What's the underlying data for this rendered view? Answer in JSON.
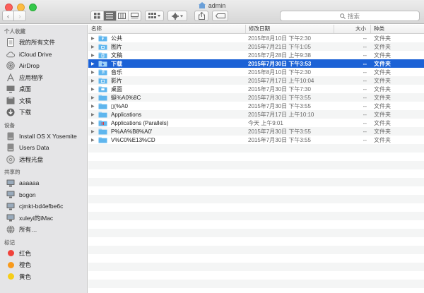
{
  "window": {
    "title": "admin"
  },
  "toolbar": {
    "back": "‹",
    "forward": "›",
    "search_placeholder": "搜索"
  },
  "sidebar": {
    "favorites_title": "个人收藏",
    "favorites": [
      {
        "label": "我的所有文件",
        "icon": "all-files-icon"
      },
      {
        "label": "iCloud Drive",
        "icon": "cloud-icon"
      },
      {
        "label": "AirDrop",
        "icon": "airdrop-icon"
      },
      {
        "label": "应用程序",
        "icon": "applications-icon"
      },
      {
        "label": "桌面",
        "icon": "desktop-icon"
      },
      {
        "label": "文稿",
        "icon": "documents-icon"
      },
      {
        "label": "下载",
        "icon": "downloads-icon"
      }
    ],
    "devices_title": "设备",
    "devices": [
      {
        "label": "Install OS X Yosemite",
        "icon": "disk-icon"
      },
      {
        "label": "Users Data",
        "icon": "disk-icon"
      },
      {
        "label": "远程光盘",
        "icon": "remote-disc-icon"
      }
    ],
    "shared_title": "共享的",
    "shared": [
      {
        "label": "aaaaaa",
        "icon": "monitor-icon"
      },
      {
        "label": "bogon",
        "icon": "monitor-icon"
      },
      {
        "label": "cjmkt-bd4efbe6c",
        "icon": "monitor-icon"
      },
      {
        "label": "xuleyi的iMac",
        "icon": "monitor-icon"
      },
      {
        "label": "所有…",
        "icon": "network-icon"
      }
    ],
    "tags_title": "标记",
    "tags": [
      {
        "label": "红色",
        "color": "#f0423b"
      },
      {
        "label": "橙色",
        "color": "#f89a1c"
      },
      {
        "label": "黄色",
        "color": "#f6cd18"
      }
    ]
  },
  "columns": {
    "name": "名称",
    "date": "修改日期",
    "size": "大小",
    "kind": "种类"
  },
  "files": [
    {
      "name": "公共",
      "date": "2015年8月10日 下午2:30",
      "size": "--",
      "kind": "文件夹",
      "icon": "public-folder-icon"
    },
    {
      "name": "图片",
      "date": "2015年7月21日 下午1:05",
      "size": "--",
      "kind": "文件夹",
      "icon": "pictures-folder-icon"
    },
    {
      "name": "文稿",
      "date": "2015年7月28日 上午9:38",
      "size": "--",
      "kind": "文件夹",
      "icon": "documents-folder-icon"
    },
    {
      "name": "下载",
      "date": "2015年7月30日 下午3:53",
      "size": "--",
      "kind": "文件夹",
      "icon": "downloads-folder-icon",
      "selected": true
    },
    {
      "name": "音乐",
      "date": "2015年8月10日 下午2:30",
      "size": "--",
      "kind": "文件夹",
      "icon": "music-folder-icon"
    },
    {
      "name": "影片",
      "date": "2015年7月17日 上午10:04",
      "size": "--",
      "kind": "文件夹",
      "icon": "movies-folder-icon"
    },
    {
      "name": "桌面",
      "date": "2015年7月30日 下午7:30",
      "size": "--",
      "kind": "文件夹",
      "icon": "desktop-folder-icon"
    },
    {
      "name": "蜓%A0%8C",
      "date": "2015年7月30日 下午3:55",
      "size": "--",
      "kind": "文件夹",
      "icon": "folder-icon"
    },
    {
      "name": "▯(%A0",
      "date": "2015年7月30日 下午3:55",
      "size": "--",
      "kind": "文件夹",
      "icon": "folder-icon"
    },
    {
      "name": "Applications",
      "date": "2015年7月17日 上午10:10",
      "size": "--",
      "kind": "文件夹",
      "icon": "folder-icon"
    },
    {
      "name": "Applications (Parallels)",
      "date": "今天 上午9:01",
      "size": "--",
      "kind": "文件夹",
      "icon": "parallels-folder-icon"
    },
    {
      "name": "P%AA%B8%A0'",
      "date": "2015年7月30日 下午3:55",
      "size": "--",
      "kind": "文件夹",
      "icon": "folder-icon"
    },
    {
      "name": "V%C0%E13%CD",
      "date": "2015年7月30日 下午3:55",
      "size": "--",
      "kind": "文件夹",
      "icon": "folder-icon"
    }
  ],
  "colors": {
    "selection": "#1c62d6",
    "folder": "#5fb6ee",
    "sidebar_bg": "#e5e5e7"
  }
}
